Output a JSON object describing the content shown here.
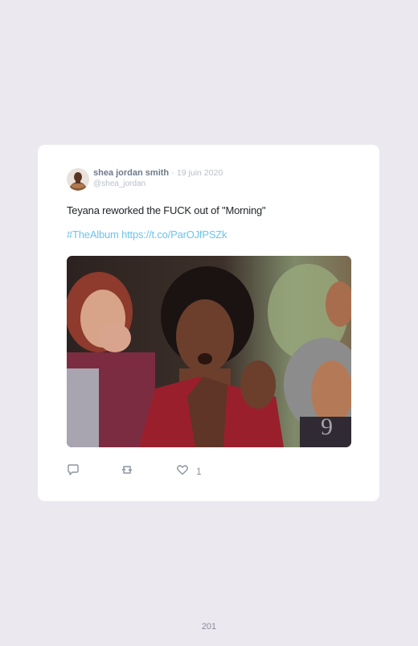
{
  "tweet": {
    "author_name": "shea jordan smith",
    "separator": "·",
    "date": "19 juin 2020",
    "handle": "@shea_jordan",
    "text": "Teyana reworked the FUCK out of \"Morning\"",
    "hashtag": "#TheAlbum",
    "link": "https://t.co/ParOJfPSZk",
    "media_description_icon": "gif-media",
    "like_count": "1"
  },
  "icons": {
    "reply": "reply-icon",
    "retweet": "retweet-icon",
    "like": "heart-icon"
  },
  "colors": {
    "page_background": "#ece8ef",
    "card_background": "#ffffff",
    "link": "#6cc4ea",
    "muted": "#b8bec7"
  },
  "page_number": "201"
}
